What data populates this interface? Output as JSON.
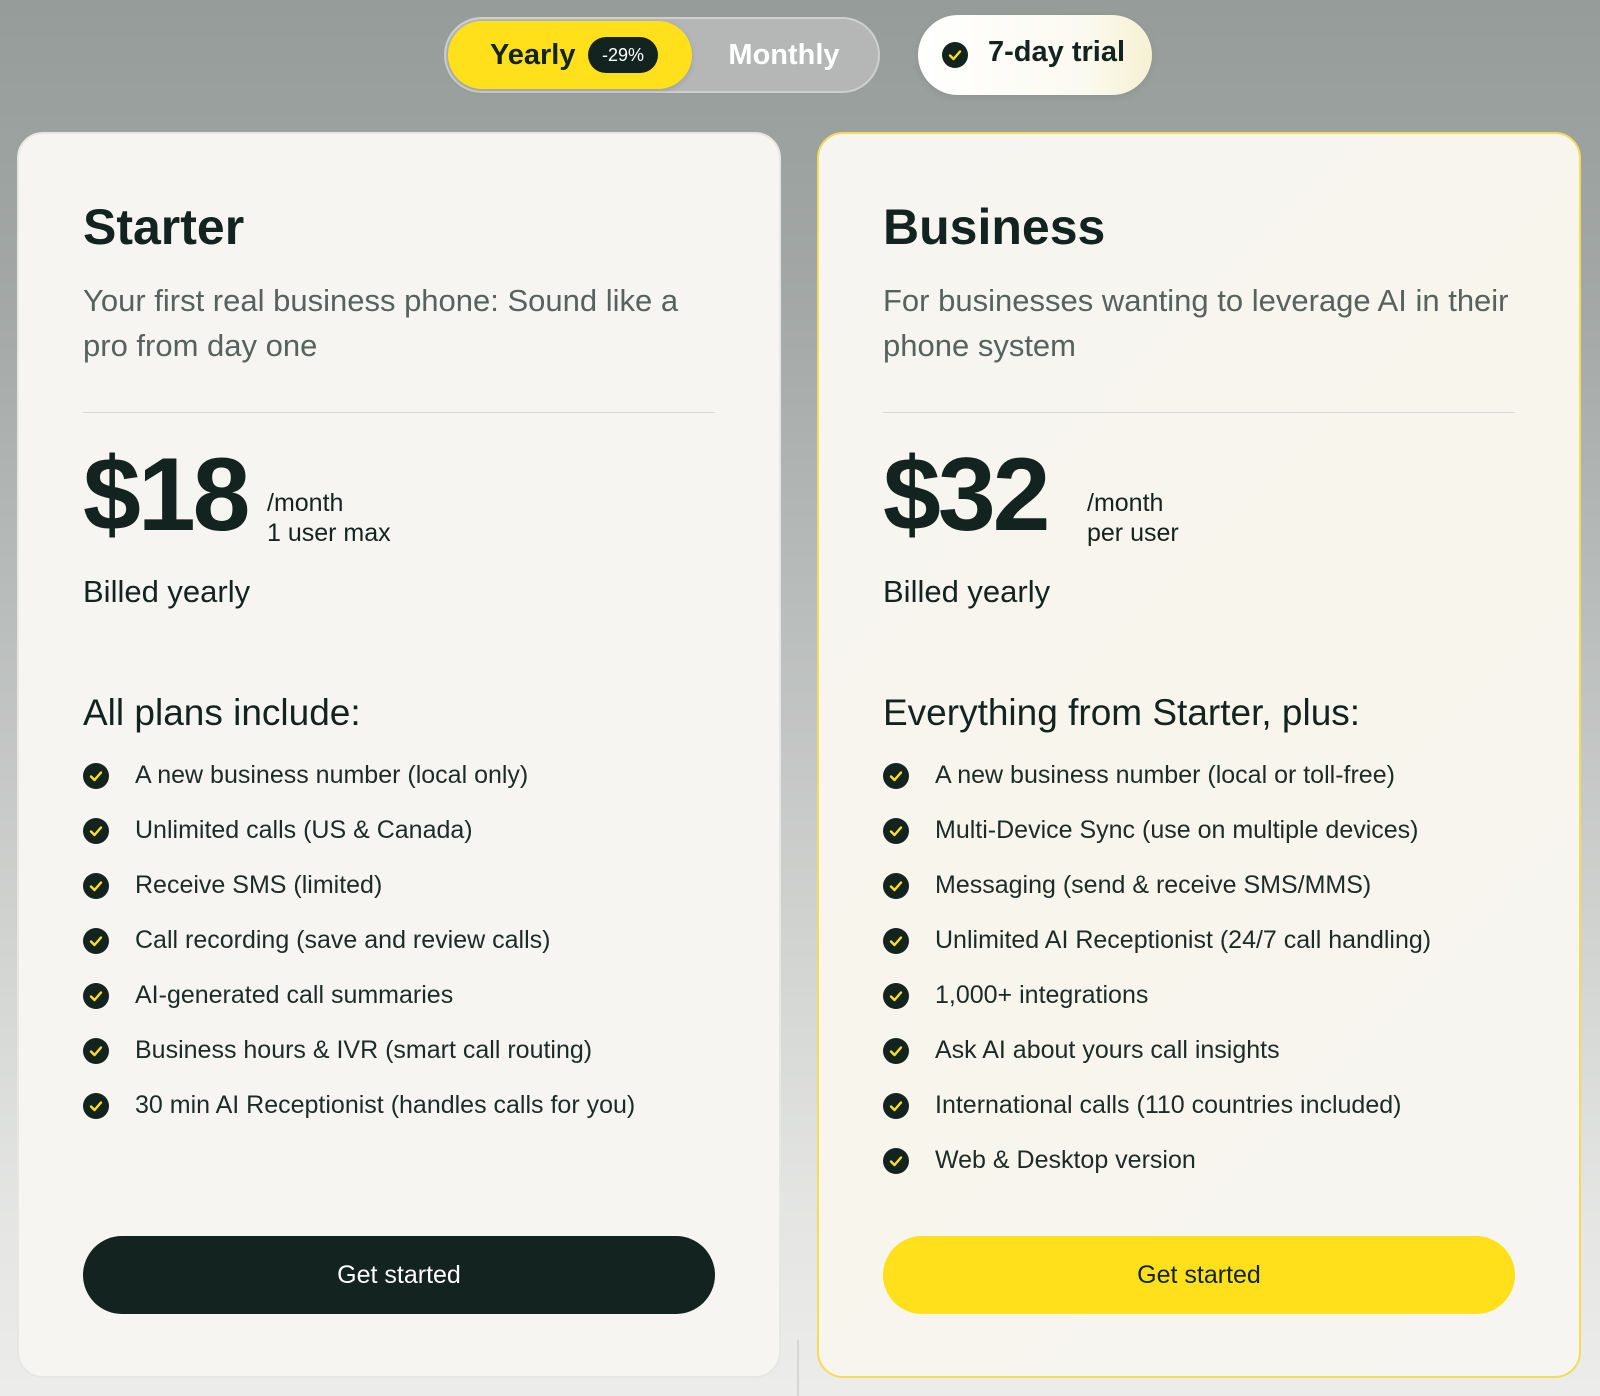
{
  "billing_toggle": {
    "yearly_label": "Yearly",
    "discount_badge": "-29%",
    "monthly_label": "Monthly",
    "selected": "Yearly"
  },
  "trial": {
    "label": "7-day trial",
    "icon": "check-circle-icon"
  },
  "colors": {
    "accent_yellow": "#ffe01a",
    "dark": "#13231f",
    "card_bg": "#f6f5f2"
  },
  "plans": [
    {
      "name": "Starter",
      "description": "Your first real business phone: Sound like a pro from day one",
      "price": "$18",
      "price_period": "/month",
      "price_note": "1 user max",
      "billing": "Billed yearly",
      "features_heading": "All plans include:",
      "features": [
        "A new business number (local only)",
        "Unlimited calls (US & Canada)",
        "Receive SMS (limited)",
        "Call recording (save and review calls)",
        "AI-generated call summaries",
        "Business hours & IVR (smart call routing)",
        "30 min AI Receptionist (handles calls for you)"
      ],
      "cta_label": "Get started"
    },
    {
      "name": "Business",
      "description": "For businesses wanting to leverage AI in their phone system",
      "price": "$32",
      "price_period": "/month",
      "price_note": "per user",
      "billing": "Billed yearly",
      "features_heading": "Everything from Starter, plus:",
      "features": [
        "A new business number (local or toll-free)",
        "Multi-Device Sync (use on multiple devices)",
        "Messaging (send & receive SMS/MMS)",
        "Unlimited AI Receptionist (24/7 call handling)",
        "1,000+ integrations",
        "Ask AI about yours call insights",
        "International calls (110 countries included)",
        "Web & Desktop version"
      ],
      "cta_label": "Get started"
    }
  ]
}
